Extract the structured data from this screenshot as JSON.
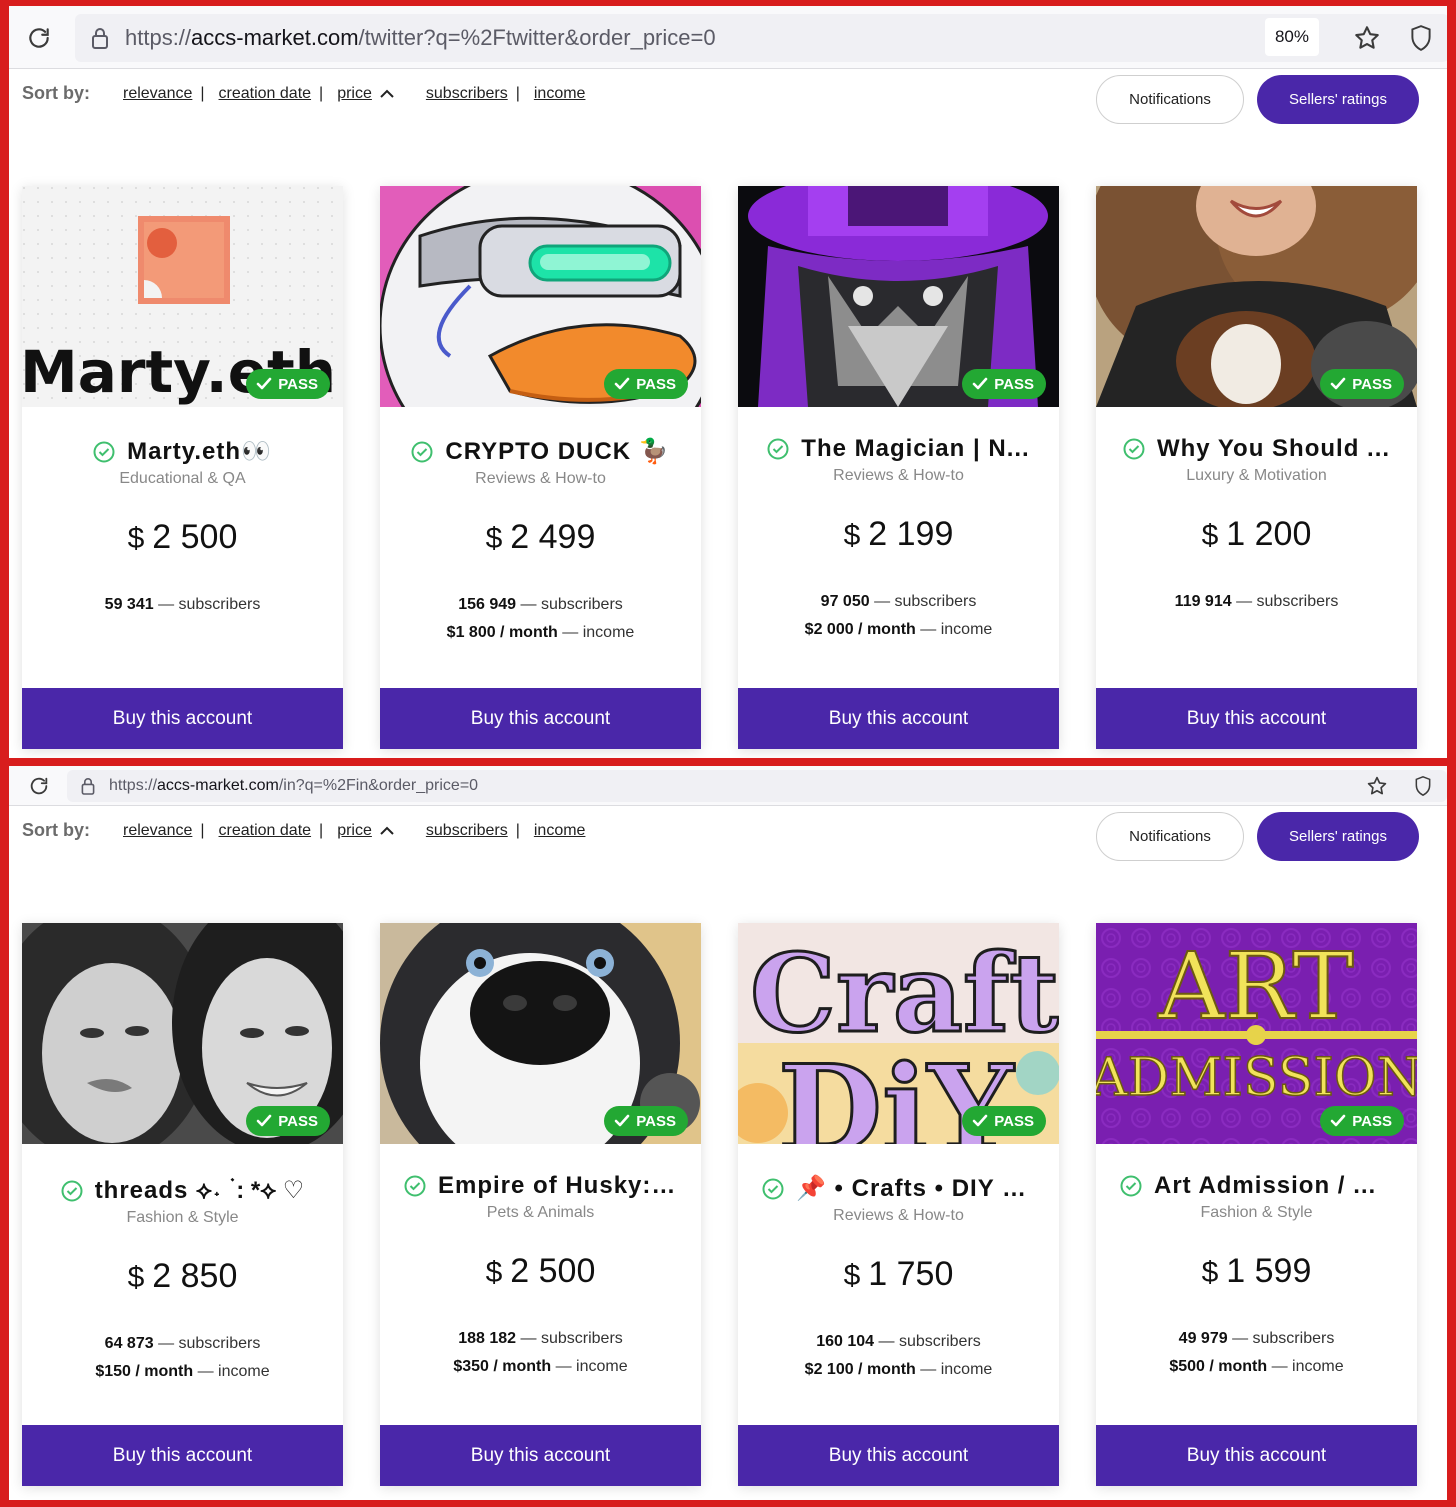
{
  "panels": [
    {
      "url": {
        "prefix": "https://",
        "domain": "accs-market.com",
        "path": "/twitter?q=%2Ftwitter&order_price=0"
      },
      "zoom": "80%",
      "sort": {
        "label": "Sort by:",
        "options": [
          "relevance",
          "creation date",
          "price",
          "subscribers",
          "income"
        ]
      },
      "notifications_label": "Notifications",
      "ratings_label": "Sellers' ratings",
      "cards": [
        {
          "title": "Marty.eth👀",
          "category": "Educational & QA",
          "currency": "$",
          "price": "2 500",
          "subscribers": "59 341",
          "subscribers_label": "— subscribers",
          "income": "",
          "income_label": "",
          "pass": "PASS",
          "buy": "Buy this account",
          "image": "marty-logo",
          "image_text": "Marty.eth"
        },
        {
          "title": "CRYPTO DUCK 🦆",
          "category": "Reviews & How-to",
          "currency": "$",
          "price": "2 499",
          "subscribers": "156 949",
          "subscribers_label": "— subscribers",
          "income": "$1 800 / month",
          "income_label": "— income",
          "pass": "PASS",
          "buy": "Buy this account",
          "image": "crypto-duck",
          "image_text": ""
        },
        {
          "title": "The Magician | N...",
          "category": "Reviews & How-to",
          "currency": "$",
          "price": "2 199",
          "subscribers": "97 050",
          "subscribers_label": "— subscribers",
          "income": "$2 000 / month",
          "income_label": "— income",
          "pass": "PASS",
          "buy": "Buy this account",
          "image": "magician",
          "image_text": ""
        },
        {
          "title": "Why You Should ...",
          "category": "Luxury & Motivation",
          "currency": "$",
          "price": "1 200",
          "subscribers": "119 914",
          "subscribers_label": "— subscribers",
          "income": "",
          "income_label": "",
          "pass": "PASS",
          "buy": "Buy this account",
          "image": "woman-with-dog",
          "image_text": ""
        }
      ]
    },
    {
      "url": {
        "prefix": "https://",
        "domain": "accs-market.com",
        "path": "/in?q=%2Fin&order_price=0"
      },
      "sort": {
        "label": "Sort by:",
        "options": [
          "relevance",
          "creation date",
          "price",
          "subscribers",
          "income"
        ]
      },
      "notifications_label": "Notifications",
      "ratings_label": "Sellers' ratings",
      "cards": [
        {
          "title": "threads ⟡˖ ࣪ : *⟡ ♡",
          "category": "Fashion & Style",
          "currency": "$",
          "price": "2 850",
          "subscribers": "64 873",
          "subscribers_label": "— subscribers",
          "income": "$150 / month",
          "income_label": "— income",
          "pass": "PASS",
          "buy": "Buy this account",
          "image": "two-women-bw",
          "image_text": ""
        },
        {
          "title": "Empire of Husky: ...",
          "category": "Pets & Animals",
          "currency": "$",
          "price": "2 500",
          "subscribers": "188 182",
          "subscribers_label": "— subscribers",
          "income": "$350 / month",
          "income_label": "— income",
          "pass": "PASS",
          "buy": "Buy this account",
          "image": "husky",
          "image_text": ""
        },
        {
          "title": "📌 • Crafts • DIY • ...",
          "category": "Reviews & How-to",
          "currency": "$",
          "price": "1 750",
          "subscribers": "160 104",
          "subscribers_label": "— subscribers",
          "income": "$2 100 / month",
          "income_label": "— income",
          "pass": "PASS",
          "buy": "Buy this account",
          "image": "craft-diy",
          "image_text": "Craft DiY"
        },
        {
          "title": "Art Admission / A...",
          "category": "Fashion & Style",
          "currency": "$",
          "price": "1 599",
          "subscribers": "49 979",
          "subscribers_label": "— subscribers",
          "income": "$500 / month",
          "income_label": "— income",
          "pass": "PASS",
          "buy": "Buy this account",
          "image": "art-admission",
          "image_text": "ART ADMISSION"
        }
      ]
    }
  ],
  "colors": {
    "accent": "#4a27a9",
    "pass_green": "#23a833",
    "verified_green": "#3fbf6e",
    "frame_red": "#d81d1d"
  }
}
